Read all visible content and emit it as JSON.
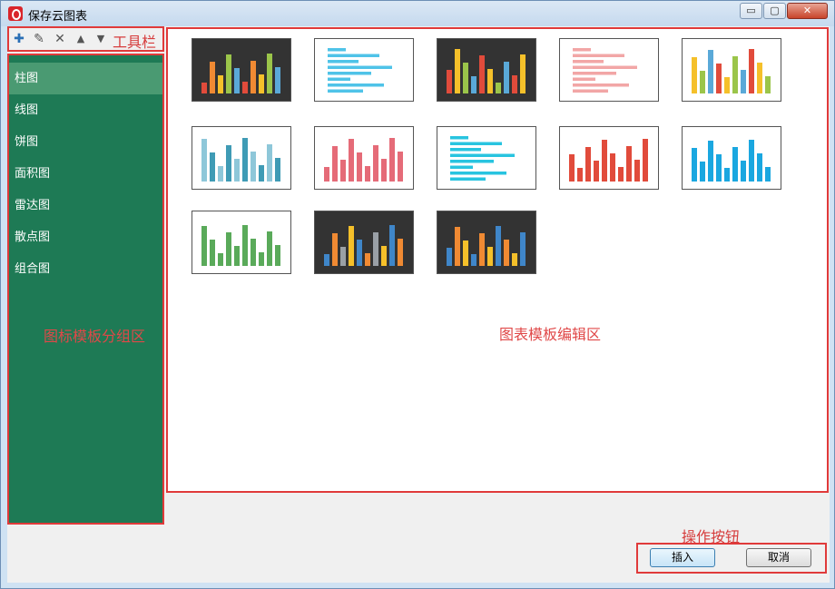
{
  "window": {
    "title": "保存云图表",
    "min_glyph": "▭",
    "max_glyph": "▢",
    "close_glyph": "✕"
  },
  "toolbar": {
    "label": "工具栏",
    "icons": {
      "add": "✚",
      "edit": "✎",
      "delete": "✕",
      "up": "▲",
      "down": "▼"
    }
  },
  "groups": {
    "area_label": "图标模板分组区",
    "items": [
      {
        "label": "柱图"
      },
      {
        "label": "线图"
      },
      {
        "label": "饼图"
      },
      {
        "label": "面积图"
      },
      {
        "label": "雷达图"
      },
      {
        "label": "散点图"
      },
      {
        "label": "组合图"
      }
    ]
  },
  "main": {
    "area_label": "图表模板编辑区",
    "templates": [
      {
        "style": "dark"
      },
      {
        "style": "light"
      },
      {
        "style": "dark"
      },
      {
        "style": "light"
      },
      {
        "style": "light"
      },
      {
        "style": "light"
      },
      {
        "style": "light"
      },
      {
        "style": "light"
      },
      {
        "style": "light"
      },
      {
        "style": "light"
      },
      {
        "style": "light"
      },
      {
        "style": "dark"
      },
      {
        "style": "dark"
      }
    ]
  },
  "actions": {
    "area_label": "操作按钮",
    "insert_label": "插入",
    "cancel_label": "取消"
  },
  "colors": {
    "panel_green": "#1e7a55",
    "active_item": "#4a9a72",
    "annotation_red": "#e03a3a"
  }
}
